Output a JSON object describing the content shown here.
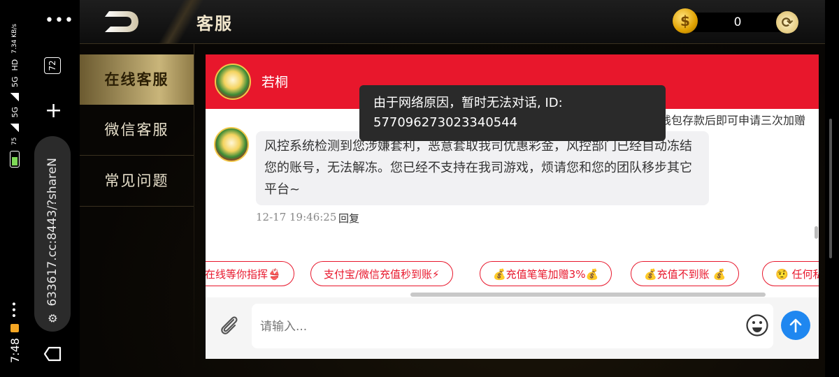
{
  "system": {
    "time": "7:48",
    "net_speed": "7.34 KB/s",
    "battery": "75",
    "network_labels": [
      "5G",
      "5G",
      "HD"
    ],
    "tab_count": "72",
    "url": "633617.cc:8443/?shareN"
  },
  "header": {
    "title": "客服",
    "balance": "0"
  },
  "sidebar": {
    "items": [
      {
        "label": "在线客服"
      },
      {
        "label": "微信客服"
      },
      {
        "label": "常见问题"
      }
    ]
  },
  "chat": {
    "agent_name": "若桐",
    "partial_notice": "钱包存款后即可申请三次加赠",
    "message_text": "风控系统检测到您涉嫌套利，恶意套取我司优惠彩金，风控部门已经自动冻结您的账号，无法解冻。您已经不支持在我司游戏，烦请您和您的团队移步其它平台~",
    "message_time": "12-17 19:46:25",
    "reply_label": "回复",
    "quick_replies": [
      "在线等你指挥👙",
      "支付宝/微信充值秒到账⚡",
      "💰充值笔笔加赠3%💰",
      "💰充值不到账 💰",
      "🤨 任何私"
    ],
    "input_placeholder": "请输入..."
  },
  "toast": {
    "message": "由于网络原因，暂时无法对话, ID: 577096273023340544"
  },
  "colors": {
    "chat_header": "#e8172c",
    "send_button": "#1f87f0",
    "gold": "#c9b57a"
  }
}
